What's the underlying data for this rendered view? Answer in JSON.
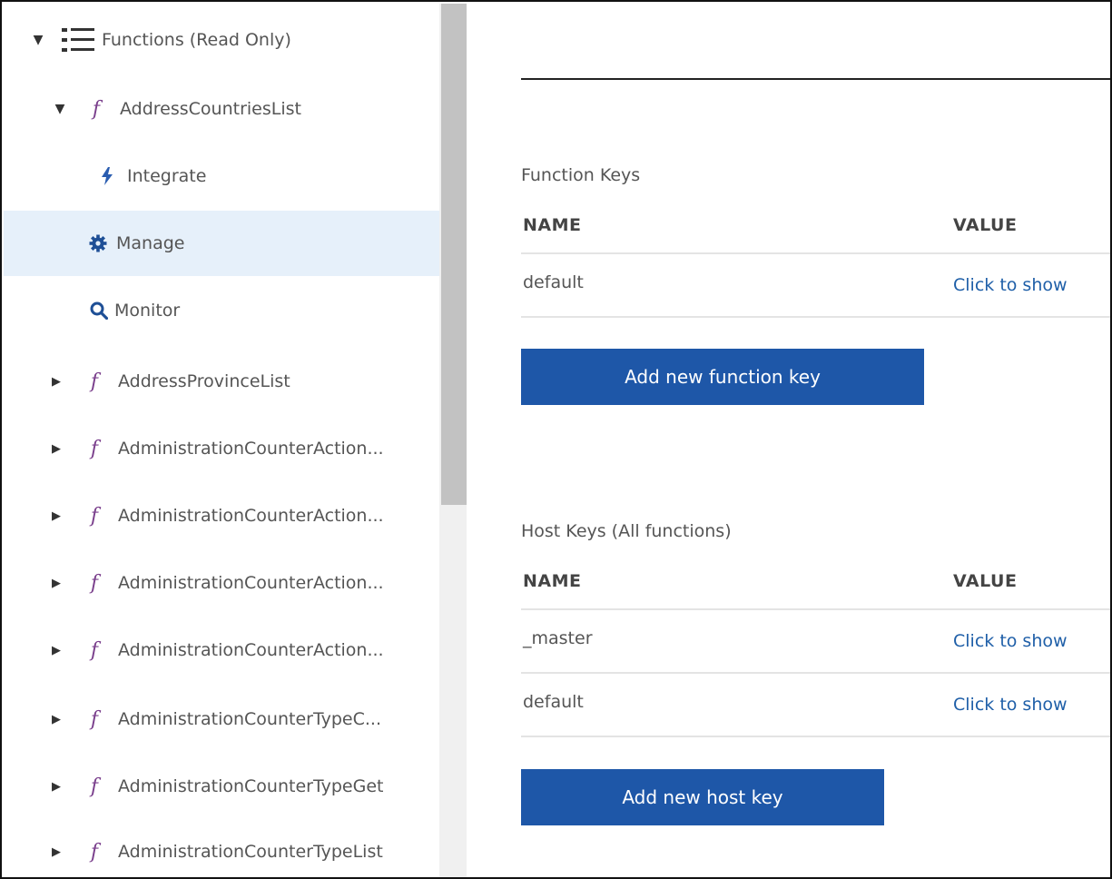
{
  "sidebar": {
    "root": {
      "label": "Functions (Read Only)",
      "icon": "list-icon",
      "expanded": true
    },
    "expanded_function": {
      "label": "AddressCountriesList",
      "icon": "function-icon",
      "children": [
        {
          "label": "Integrate",
          "icon": "lightning-icon"
        },
        {
          "label": "Manage",
          "icon": "gear-icon",
          "selected": true
        },
        {
          "label": "Monitor",
          "icon": "search-icon"
        }
      ]
    },
    "functions": [
      "AddressProvinceList",
      "AdministrationCounterAction...",
      "AdministrationCounterAction...",
      "AdministrationCounterAction...",
      "AdministrationCounterAction...",
      "AdministrationCounterTypeC...",
      "AdministrationCounterTypeGet",
      "AdministrationCounterTypeList"
    ]
  },
  "main": {
    "function_keys": {
      "title": "Function Keys",
      "col_name": "NAME",
      "col_value": "VALUE",
      "rows": [
        {
          "name": "default",
          "value": "Click to show"
        }
      ],
      "add_button": "Add new function key"
    },
    "host_keys": {
      "title": "Host Keys (All functions)",
      "col_name": "NAME",
      "col_value": "VALUE",
      "rows": [
        {
          "name": "_master",
          "value": "Click to show"
        },
        {
          "name": "default",
          "value": "Click to show"
        }
      ],
      "add_button": "Add new host key"
    }
  },
  "colors": {
    "accent": "#1e57a8",
    "link": "#1f5fa8",
    "function_icon": "#7a3f8c",
    "selected_bg": "#e6f0fa"
  }
}
